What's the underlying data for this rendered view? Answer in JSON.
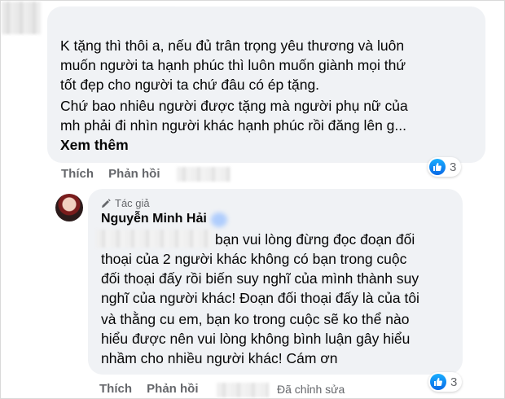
{
  "comment1": {
    "lines": [
      "K tặng thì thôi a, nếu đủ trân trọng yêu thương và luôn",
      "muốn người ta hạnh phúc thì luôn muốn giành mọi thứ",
      "tốt đẹp cho người ta chứ đâu có ép tặng.",
      "Chứ bao nhiêu người được tặng mà người phụ nữ của",
      "mh phải đi nhìn người khác hạnh phúc rồi đăng lên g..."
    ],
    "see_more": "Xem thêm",
    "like_label": "Thích",
    "reply_label": "Phản hồi",
    "reaction_count": "3"
  },
  "reply": {
    "author_badge": "Tác giả",
    "author_name": "Nguyễn Minh Hải",
    "lines": [
      "bạn vui lòng đừng đọc đoạn đối",
      "thoại của 2 người khác không có bạn trong cuộc",
      "đối thoại đấy rồi biến suy nghĩ của mình thành suy",
      "nghĩ của người khác! Đoạn đối thoại đấy là của tôi",
      "và thằng cu em, bạn ko trong cuộc sẽ ko thể nào",
      "hiểu được nên vui lòng không bình luận gây hiểu",
      "nhầm cho nhiều người khác! Cám ơn"
    ],
    "like_label": "Thích",
    "reply_label": "Phản hồi",
    "edited_label": "Đã chỉnh sửa",
    "reaction_count": "3"
  },
  "colors": {
    "bubble": "#f0f2f5",
    "text": "#050505",
    "secondary": "#65676b",
    "like_blue": "#1877f2"
  }
}
